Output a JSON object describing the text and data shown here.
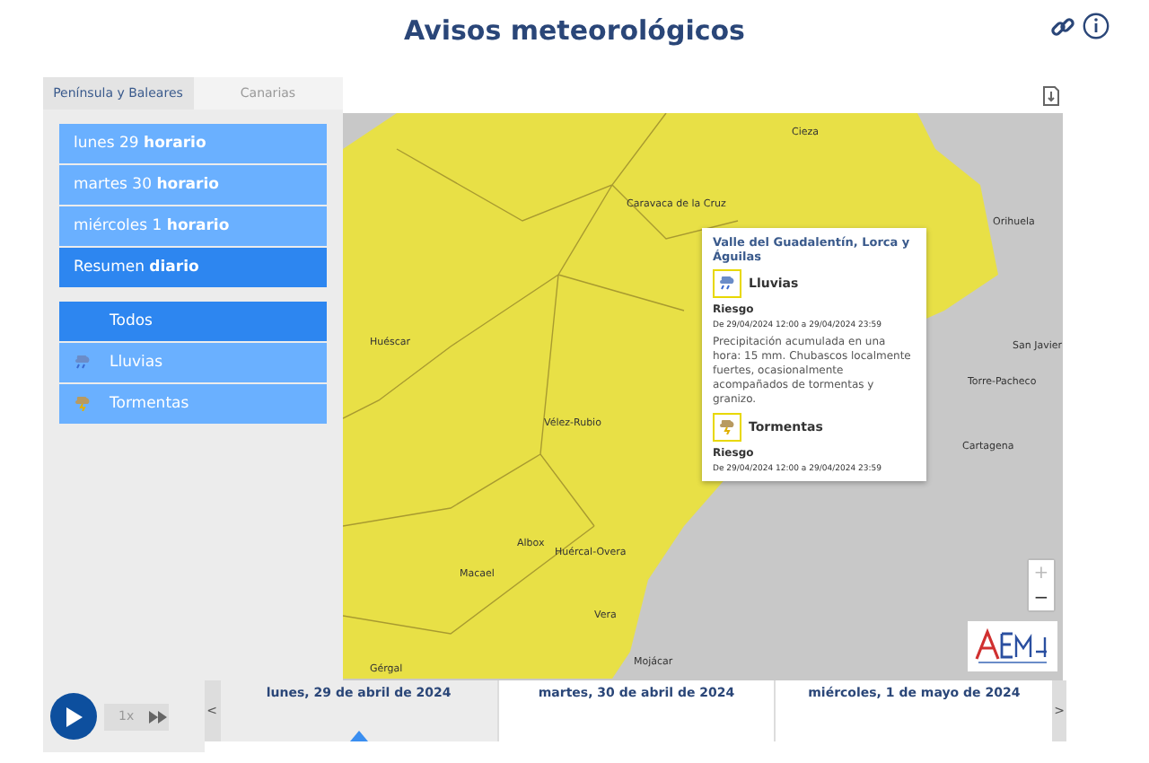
{
  "header": {
    "title": "Avisos meteorológicos"
  },
  "region_tabs": [
    {
      "label": "Península y Baleares",
      "selected": true
    },
    {
      "label": "Canarias",
      "selected": false
    }
  ],
  "day_items": [
    {
      "label": "lunes 29 **horario**",
      "selected": false
    },
    {
      "label": "martes 30 **horario**",
      "selected": false
    },
    {
      "label": "miércoles 1 **horario**",
      "selected": false
    },
    {
      "label": "Resumen **diario**",
      "selected": true
    }
  ],
  "phenomena": [
    {
      "label": "Todos",
      "kind": "all",
      "selected": true
    },
    {
      "label": "Lluvias",
      "kind": "rain",
      "selected": false
    },
    {
      "label": "Tormentas",
      "kind": "storm",
      "selected": false
    }
  ],
  "map": {
    "places": [
      "Cieza",
      "Caravaca de la Cruz",
      "Orihuela",
      "Huéscar",
      "Vélez-Rubio",
      "San Javier",
      "Torre-Pacheco",
      "Cartagena",
      "Albox",
      "Huércal-Overa",
      "Macael",
      "Vera",
      "Mojácar",
      "Gérgal"
    ],
    "popup": {
      "zone": "Valle del Guadalentín, Lorca y Águilas",
      "warnings": [
        {
          "kind": "rain",
          "name": "Lluvias",
          "heading": "Riesgo",
          "period": "De 29/04/2024 12:00 a 29/04/2024 23:59",
          "description": "Precipitación acumulada en una hora: 15 mm. Chubascos localmente fuertes, ocasionalmente acompañados de tormentas y granizo."
        },
        {
          "kind": "storm",
          "name": "Tormentas",
          "heading": "Riesgo",
          "period": "De 29/04/2024 12:00 a 29/04/2024 23:59"
        }
      ]
    },
    "zoom_in": "+",
    "zoom_out": "−"
  },
  "player": {
    "speed": "1x",
    "prev": "<",
    "next": ">"
  },
  "timeline": [
    {
      "label": "lunes, 29 de abril de 2024",
      "selected": true
    },
    {
      "label": "martes, 30 de abril de 2024",
      "selected": false
    },
    {
      "label": "miércoles, 1 de mayo de 2024",
      "selected": false
    }
  ]
}
